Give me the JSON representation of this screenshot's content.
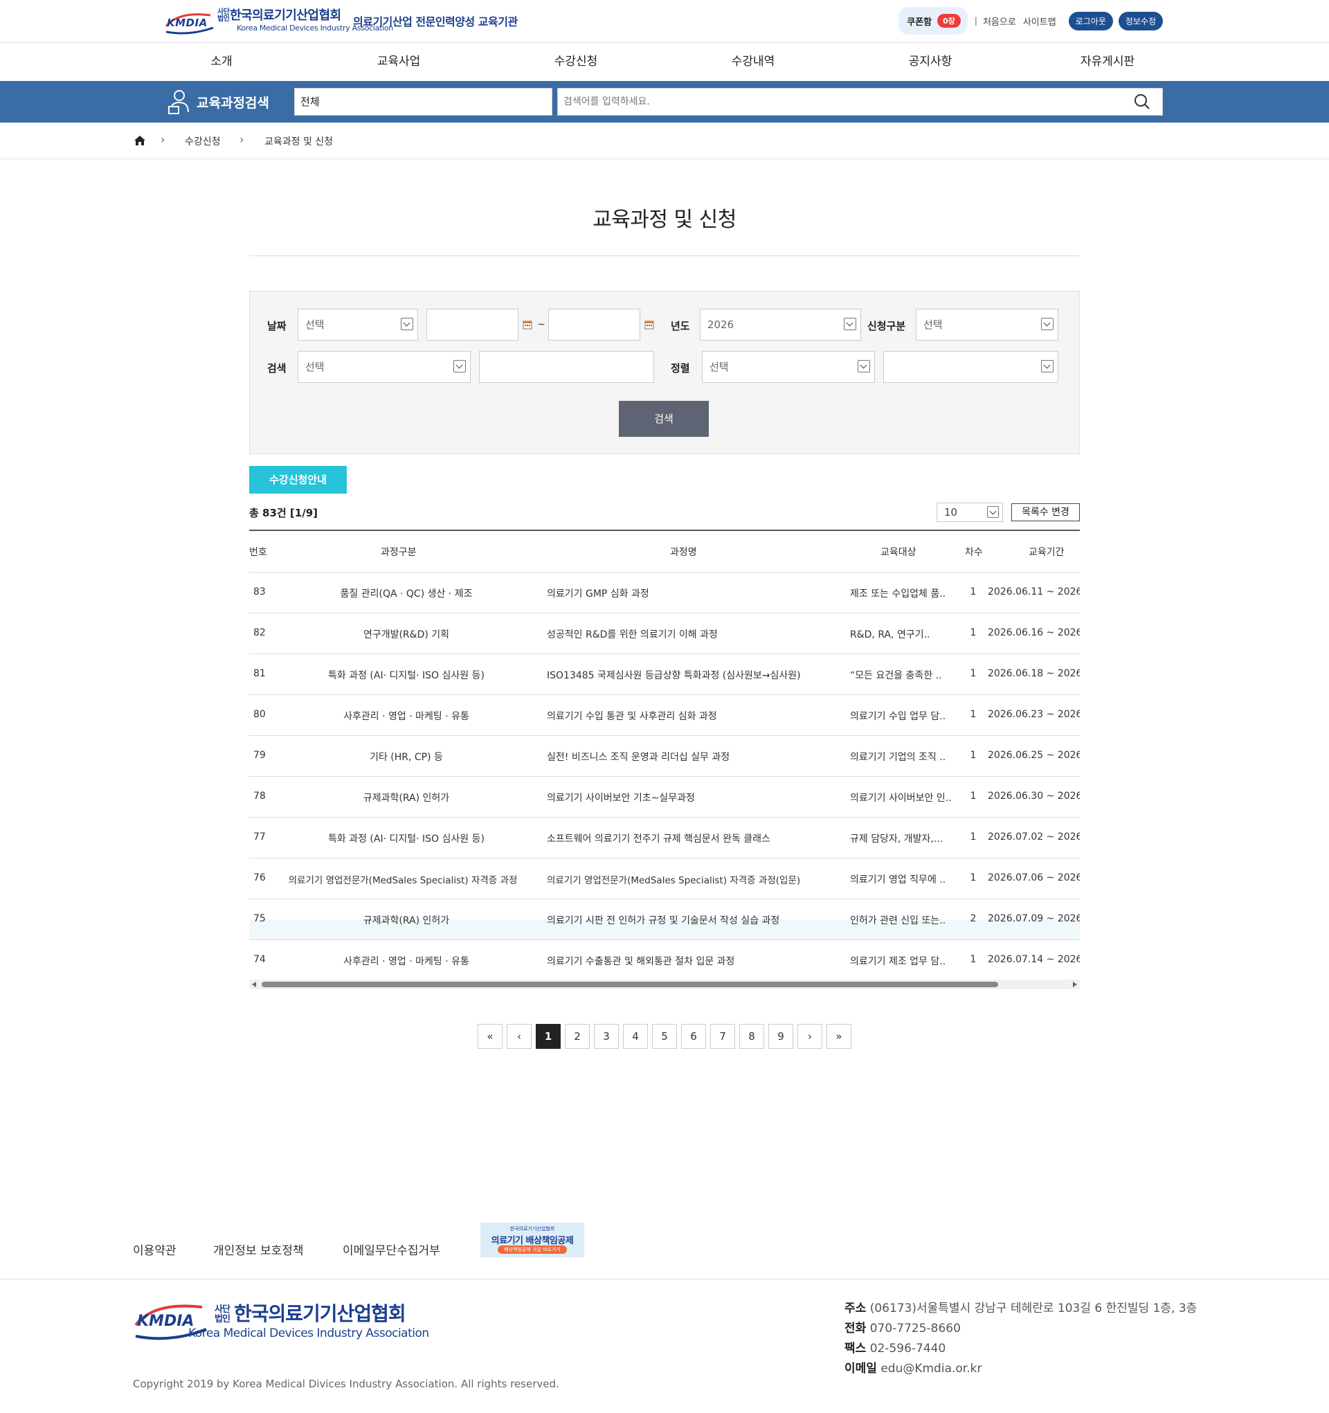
{
  "header": {
    "logo_kmdia": "KMDIA",
    "logo_small": "사단 법인",
    "logo_name": "한국의료기기산업협회",
    "logo_en": "Korea Medical Devices Industry Association",
    "tagline": "의료기기산업 전문인력양성 교육기관",
    "coupon_label": "쿠폰함",
    "coupon_count": "0장",
    "separator": "|",
    "home_link": "처음으로",
    "sitemap_link": "사이트맵",
    "logout_button": "로그아웃",
    "profile_button": "정보수정"
  },
  "nav": [
    "소개",
    "교육사업",
    "수강신청",
    "수강내역",
    "공지사항",
    "자유게시판"
  ],
  "search": {
    "title": "교육과정검색",
    "category": "전체",
    "placeholder": "검색어를 입력하세요."
  },
  "breadcrumb": [
    "수강신청",
    "교육과정 및 신청"
  ],
  "page_title": "교육과정 및 신청",
  "filter": {
    "date_label": "날짜",
    "date_select": "선택",
    "tilde": "~",
    "year_label": "년도",
    "year_value": "2026",
    "apply_type_label": "신청구분",
    "apply_type_value": "선택",
    "search_label": "검색",
    "search_select": "선택",
    "sort_label": "정렬",
    "sort_select": "선택",
    "search_button": "검색"
  },
  "list": {
    "guide_button": "수강신청안내",
    "total": "총 83건 [1/9]",
    "per_page": "10",
    "change_button": "목록수 변경",
    "headers": [
      "번호",
      "과정구분",
      "과정명",
      "교육대상",
      "차수",
      "교육기간"
    ],
    "rows": [
      {
        "no": "83",
        "category": "품질 관리(QA · QC) 생산 · 제조",
        "name": "의료기기 GMP 심화 과정",
        "target": "제조 또는 수입업체 품..",
        "round": "1",
        "period": "2026.06.11 ~ 2026"
      },
      {
        "no": "82",
        "category": "연구개발(R&D) 기획",
        "name": "성공적인 R&D를 위한 의료기기 이해 과정",
        "target": "R&D, RA, 연구기..",
        "round": "1",
        "period": "2026.06.16 ~ 2026"
      },
      {
        "no": "81",
        "category": "특화 과정 (AI· 디지털· ISO 심사원 등)",
        "name": "ISO13485 국제심사원 등급상향 특화과정 (심사원보→심사원)",
        "target": "“모든 요건을 충족한 ..",
        "round": "1",
        "period": "2026.06.18 ~ 2026"
      },
      {
        "no": "80",
        "category": "사후관리 · 영업 · 마케팅 · 유통",
        "name": "의료기기 수입 통관 및 사후관리 심화 과정",
        "target": "의료기기 수입 업무 담..",
        "round": "1",
        "period": "2026.06.23 ~ 2026"
      },
      {
        "no": "79",
        "category": "기타 (HR, CP) 등",
        "name": "실전! 비즈니스 조직 운영과 리더십 실무 과정",
        "target": "의료기기 기업의 조직 ..",
        "round": "1",
        "period": "2026.06.25 ~ 2026"
      },
      {
        "no": "78",
        "category": "규제과학(RA) 인허가",
        "name": "의료기기 사이버보안 기초~실무과정",
        "target": "의료기기 사이버보안 인..",
        "round": "1",
        "period": "2026.06.30 ~ 2026"
      },
      {
        "no": "77",
        "category": "특화 과정 (AI· 디지털· ISO 심사원 등)",
        "name": "소프트웨어 의료기기 전주기 규제 핵심문서 완독 클래스",
        "target": "규제 담당자, 개발자,...",
        "round": "1",
        "period": "2026.07.02 ~ 2026"
      },
      {
        "no": "76",
        "category": "의료기기 영업전문가(MedSales Specialist) 자격증 과정",
        "name": "의료기기 영업전문가(MedSales Specialist) 자격증 과정(입문)",
        "target": "의료기기 영업 직무에 ..",
        "round": "1",
        "period": "2026.07.06 ~ 2026"
      },
      {
        "no": "75",
        "category": "규제과학(RA) 인허가",
        "name": "의료기기 시판 전 인허가 규정 및 기술문서 작성 실습 과정",
        "target": "인허가 관련 신입 또는..",
        "round": "2",
        "period": "2026.07.09 ~ 2026"
      },
      {
        "no": "74",
        "category": "사후관리 · 영업 · 마케팅 · 유통",
        "name": "의료기기 수출통관 및 해외통관 절차 입문 과정",
        "target": "의료기기 제조 업무 담..",
        "round": "1",
        "period": "2026.07.14 ~ 2026"
      }
    ]
  },
  "pagination": {
    "first": "«",
    "prev": "‹",
    "pages": [
      "1",
      "2",
      "3",
      "4",
      "5",
      "6",
      "7",
      "8",
      "9"
    ],
    "current": "1",
    "next": "›",
    "last": "»"
  },
  "footer": {
    "links": [
      "이용약관",
      "개인정보 보호정책",
      "이메일무단수집거부"
    ],
    "banner_top": "한국의료기기산업협회",
    "banner_main": "의료기기 배상책임공제",
    "banner_sub": "배상책임공제 가입 바로가기",
    "logo_kmdia": "KMDIA",
    "logo_small": "사단 법인",
    "logo_name": "한국의료기기산업협회",
    "logo_en": "Korea Medical Devices Industry Association",
    "copyright": "Copyright 2019 by Korea Medical Divices Industry Association. All rights reserved.",
    "address_label": "주소",
    "address": "(06173)서울특별시 강남구 테헤란로 103길 6 한진빌딩 1층, 3층",
    "phone_label": "전화",
    "phone": "070-7725-8660",
    "fax_label": "팩스",
    "fax": "02-596-7440",
    "email_label": "이메일",
    "email": "edu@Kmdia.or.kr"
  },
  "colors": {
    "brand": "#1b3f8f",
    "search_bar": "#3a6ca6",
    "guide_button": "#27c3d9",
    "search_button": "#5f6474",
    "badge": "#ef3b3b"
  }
}
